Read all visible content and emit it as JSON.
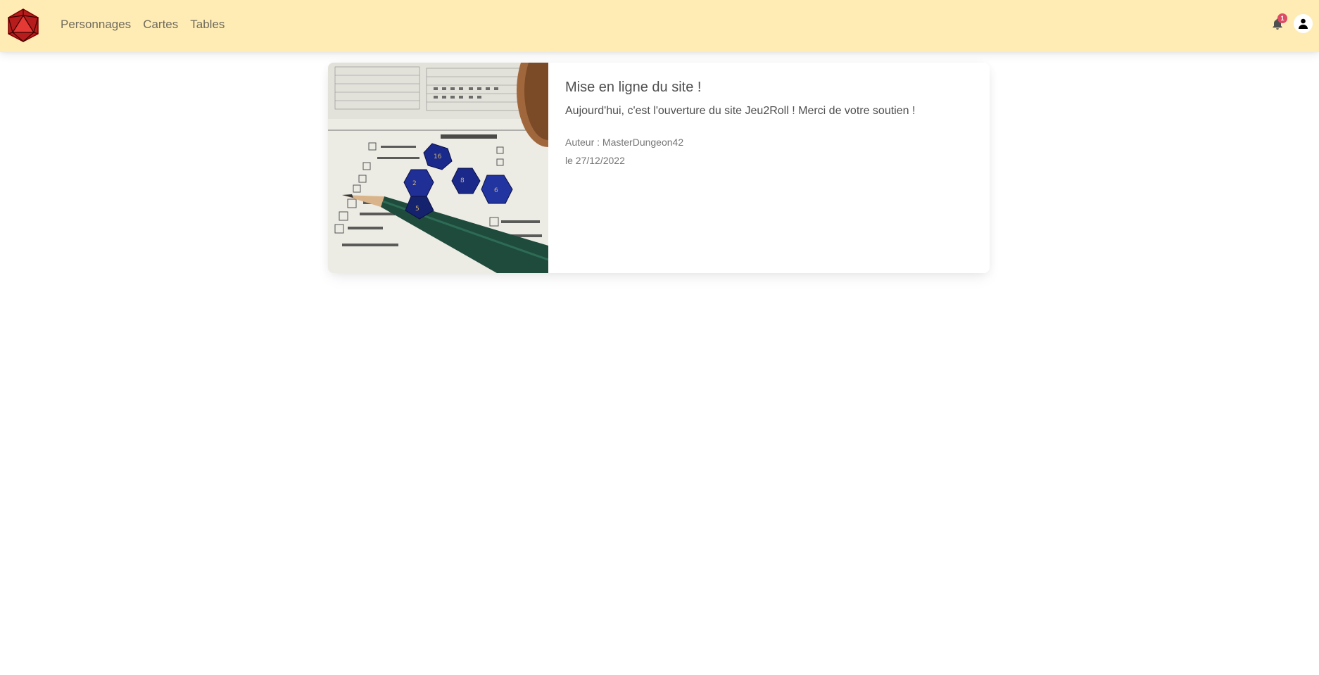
{
  "navbar": {
    "logo_icon": "d20-logo-icon",
    "links": [
      {
        "label": "Personnages"
      },
      {
        "label": "Cartes"
      },
      {
        "label": "Tables"
      }
    ],
    "notifications": {
      "icon": "bell-icon",
      "count": "1"
    },
    "user_icon": "user-icon"
  },
  "news": [
    {
      "image_icon": "dice-photo",
      "title": "Mise en ligne du site !",
      "text": "Aujourd'hui, c'est l'ouverture du site Jeu2Roll ! Merci de votre soutien !",
      "author": "Auteur : MasterDungeon42",
      "date": "le 27/12/2022"
    }
  ],
  "colors": {
    "navbar_bg": "#ffecb5",
    "logo_red": "#c62828",
    "badge": "#dc4c64",
    "dice_blue": "#1a2a8c"
  }
}
